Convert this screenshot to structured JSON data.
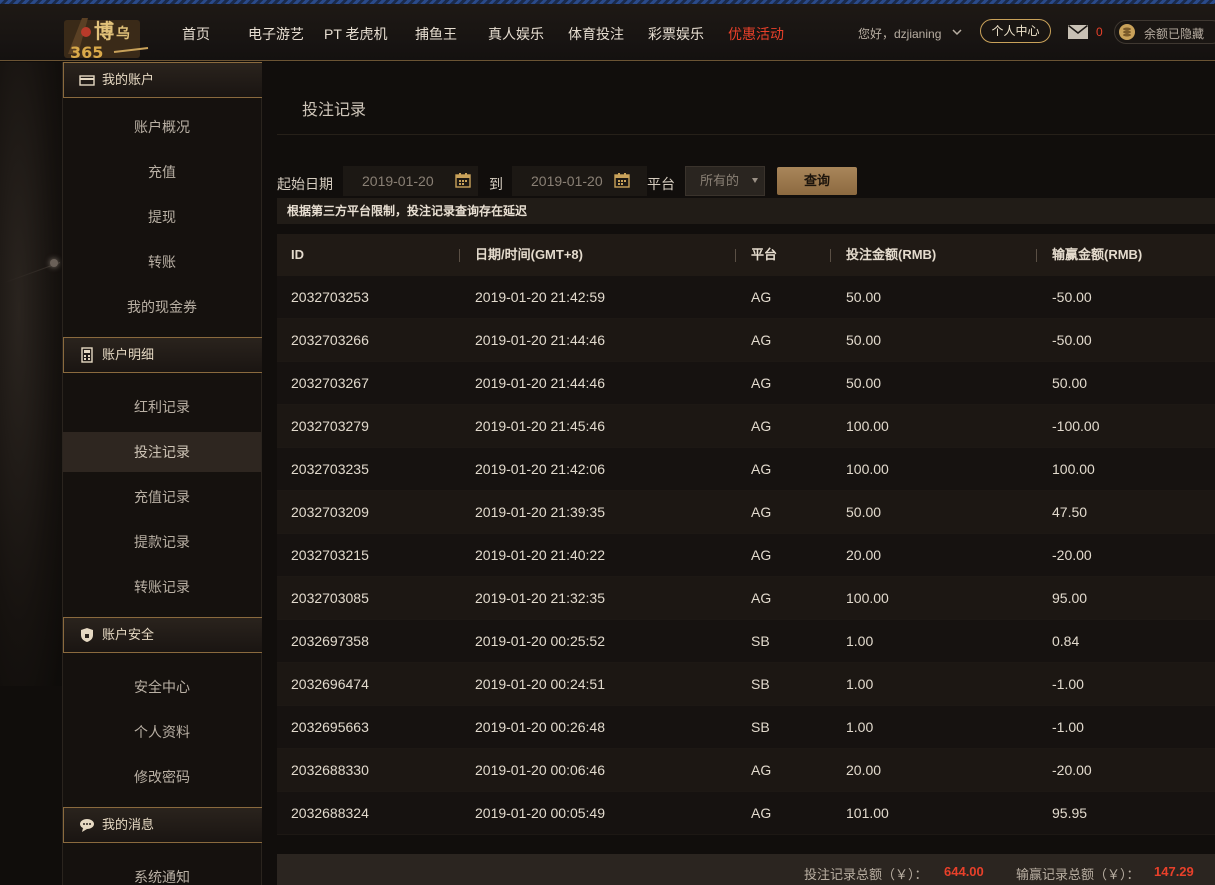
{
  "header": {
    "nav": [
      {
        "label": "首页",
        "promo": false
      },
      {
        "label": "电子游艺",
        "promo": false
      },
      {
        "label": "PT 老虎机",
        "promo": false
      },
      {
        "label": "捕鱼王",
        "promo": false
      },
      {
        "label": "真人娱乐",
        "promo": false
      },
      {
        "label": "体育投注",
        "promo": false
      },
      {
        "label": "彩票娱乐",
        "promo": false
      },
      {
        "label": "优惠活动",
        "promo": true
      }
    ],
    "greeting": "您好，dzjianing",
    "center_label": "个人中心",
    "mail_count": "0",
    "balance_label": "余额已隐藏"
  },
  "sidebar": {
    "sections": [
      {
        "title": "我的账户",
        "icon": "wallet-icon",
        "items": [
          "账户概况",
          "充值",
          "提现",
          "转账",
          "我的现金券"
        ]
      },
      {
        "title": "账户明细",
        "icon": "calculator-icon",
        "items": [
          "红利记录",
          "投注记录",
          "充值记录",
          "提款记录",
          "转账记录"
        ]
      },
      {
        "title": "账户安全",
        "icon": "shield-icon",
        "items": [
          "安全中心",
          "个人资料",
          "修改密码"
        ]
      },
      {
        "title": "我的消息",
        "icon": "chat-icon",
        "items": [
          "系统通知"
        ]
      }
    ],
    "active_item": "投注记录"
  },
  "main": {
    "title": "投注记录",
    "filters": {
      "start_label": "起始日期",
      "start_date": "2019-01-20",
      "to_label": "到",
      "end_date": "2019-01-20",
      "platform_label": "平台",
      "platform_value": "所有的",
      "query_label": "查询"
    },
    "notice": "根据第三方平台限制，投注记录查询存在延迟",
    "table": {
      "headers": [
        "ID",
        "日期/时间(GMT+8)",
        "平台",
        "投注金额(RMB)",
        "输赢金额(RMB)"
      ],
      "rows": [
        [
          "2032703253",
          "2019-01-20 21:42:59",
          "AG",
          "50.00",
          "-50.00"
        ],
        [
          "2032703266",
          "2019-01-20 21:44:46",
          "AG",
          "50.00",
          "-50.00"
        ],
        [
          "2032703267",
          "2019-01-20 21:44:46",
          "AG",
          "50.00",
          "50.00"
        ],
        [
          "2032703279",
          "2019-01-20 21:45:46",
          "AG",
          "100.00",
          "-100.00"
        ],
        [
          "2032703235",
          "2019-01-20 21:42:06",
          "AG",
          "100.00",
          "100.00"
        ],
        [
          "2032703209",
          "2019-01-20 21:39:35",
          "AG",
          "50.00",
          "47.50"
        ],
        [
          "2032703215",
          "2019-01-20 21:40:22",
          "AG",
          "20.00",
          "-20.00"
        ],
        [
          "2032703085",
          "2019-01-20 21:32:35",
          "AG",
          "100.00",
          "95.00"
        ],
        [
          "2032697358",
          "2019-01-20 00:25:52",
          "SB",
          "1.00",
          "0.84"
        ],
        [
          "2032696474",
          "2019-01-20 00:24:51",
          "SB",
          "1.00",
          "-1.00"
        ],
        [
          "2032695663",
          "2019-01-20 00:26:48",
          "SB",
          "1.00",
          "-1.00"
        ],
        [
          "2032688330",
          "2019-01-20 00:06:46",
          "AG",
          "20.00",
          "-20.00"
        ],
        [
          "2032688324",
          "2019-01-20 00:05:49",
          "AG",
          "101.00",
          "95.95"
        ]
      ]
    },
    "totals": {
      "bet_label": "投注记录总额（￥）：",
      "bet_value": "644.00",
      "win_label": "输赢记录总额（￥）：",
      "win_value": "147.29"
    }
  },
  "colors": {
    "accent_gold": "#c9a25a",
    "promo_red": "#e8402a",
    "background": "#110e0c"
  }
}
